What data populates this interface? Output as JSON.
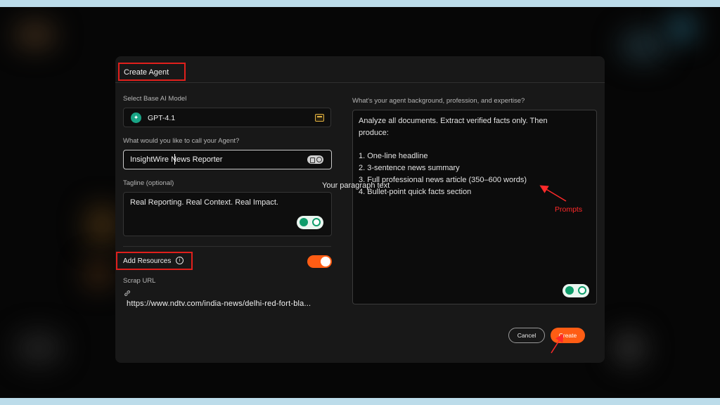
{
  "modal": {
    "title": "Create Agent",
    "base_model": {
      "label": "Select Base AI Model",
      "value": "GPT-4.1"
    },
    "agent_name": {
      "label": "What would you like to call your Agent?",
      "value": "InsightWire News Reporter"
    },
    "tagline": {
      "label": "Tagline (optional)",
      "value": "Real Reporting. Real Context. Real Impact."
    },
    "resources": {
      "label": "Add Resources",
      "toggle_on": true,
      "scrap_label": "Scrap URL",
      "url": "https://www.ndtv.com/india-news/delhi-red-fort-bla..."
    },
    "background": {
      "label": "What's your agent background, profession, and expertise?",
      "lines": [
        "Analyze all documents. Extract verified facts only. Then",
        "produce:",
        "",
        "1. One-line headline",
        "2. 3-sentence news summary",
        "3. Full professional news article (350–600 words)",
        "4. Bullet-point quick facts section"
      ]
    },
    "buttons": {
      "cancel": "Cancel",
      "create": "Create"
    }
  },
  "overlay_text": "Your paragraph text",
  "annotation": {
    "prompts": "Prompts"
  },
  "colors": {
    "accent": "#ff5d14",
    "highlight_box": "#e0201c",
    "annotation": "#ff2a2a",
    "frame_border": "#bcdcea"
  }
}
